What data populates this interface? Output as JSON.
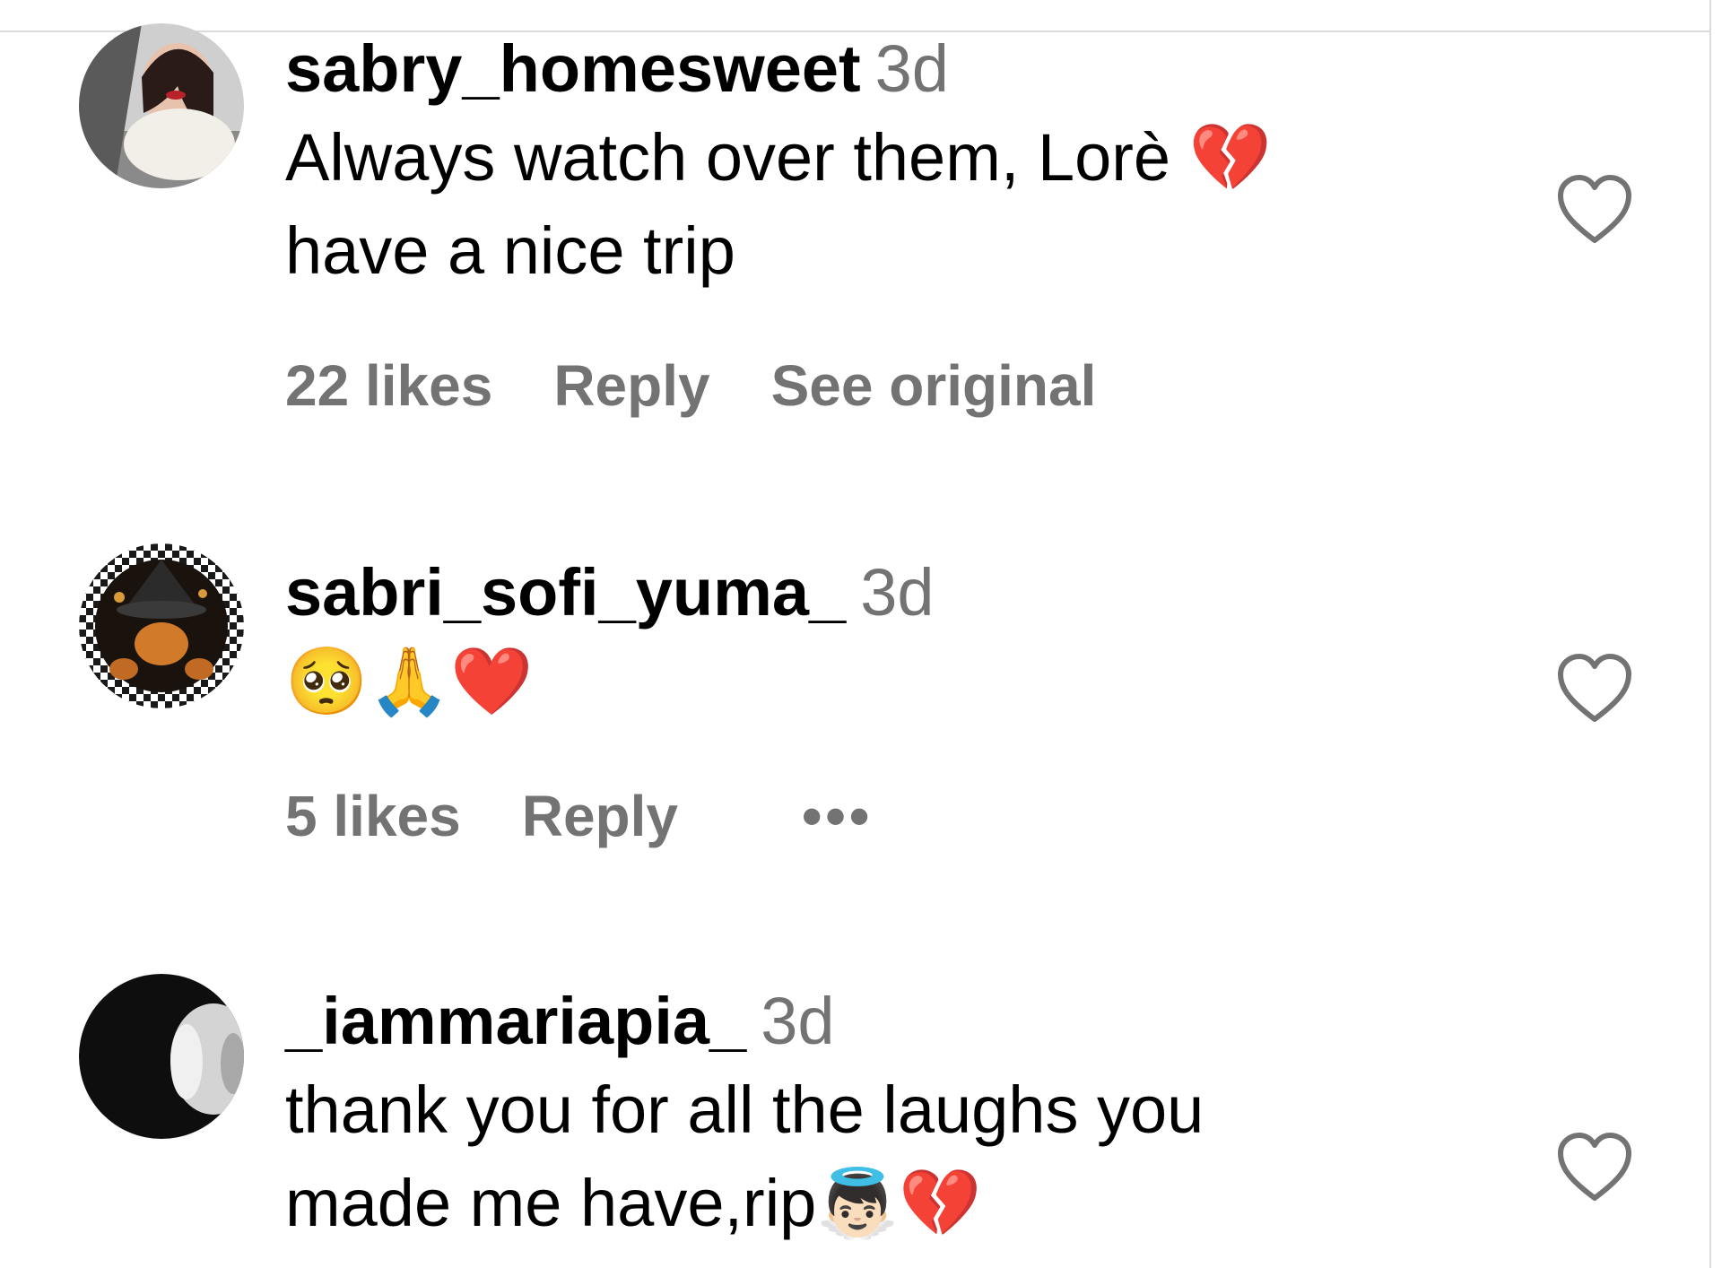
{
  "comments": [
    {
      "username": "sabry_homesweet",
      "time": "3d",
      "text_line1": "Always watch over them, Lorè 💔",
      "text_line2": "have a nice trip",
      "likes": "22 likes",
      "reply": "Reply",
      "extra": "See original"
    },
    {
      "username": "sabri_sofi_yuma_",
      "time": "3d",
      "text_line1": "🥺🙏❤️",
      "likes": "5 likes",
      "reply": "Reply",
      "extra": "•••"
    },
    {
      "username": "_iammariapia_",
      "time": "3d",
      "text_line1": "thank you for all the laughs you",
      "text_line2": "made me have,rip👼🏻💔"
    }
  ],
  "icons": {
    "like": "heart-outline-icon",
    "more": "more-horizontal-icon"
  },
  "colors": {
    "secondary_text": "#737373",
    "divider": "#dbdbdb"
  }
}
